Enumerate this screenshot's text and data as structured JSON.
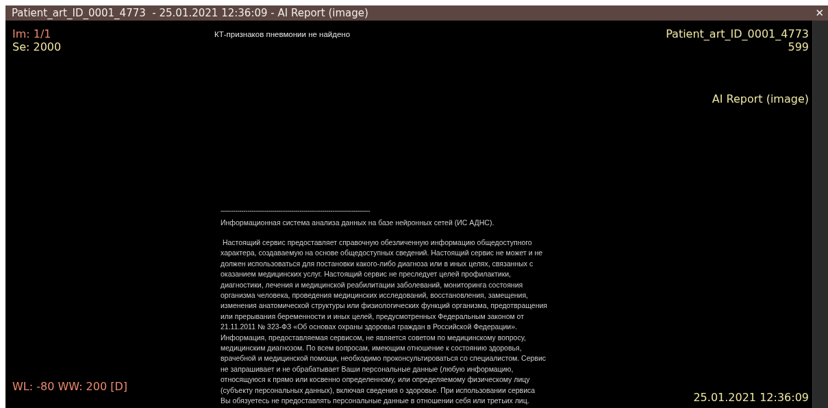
{
  "window": {
    "title": "Patient_art_ID_0001_4773  - 25.01.2021 12:36:09 - AI Report (image)",
    "close": "✕"
  },
  "overlay": {
    "image_index": "Im: 1/1",
    "series": "Se: 2000",
    "patient": "Patient_art_ID_0001_4773",
    "number": "599",
    "description": "AI Report (image)",
    "window_level": "WL: -80 WW: 200 [D]",
    "datetime": "25.01.2021 12:36:09"
  },
  "report": {
    "finding": "КТ-признаков пневмонии не найдено",
    "separator": "------------------------------------------------------------------------",
    "header": " Информационная система анализа данных на базе нейронных сетей (ИС АДНС).",
    "lines": [
      " Настоящий сервис предоставляет справочную обезличенную информацию общедоступного",
      "характера, создаваемую на основе общедоступных сведений. Настоящий сервис не может и не",
      "должен использоваться для постановки какого-либо диагноза или в иных целях, связанных с",
      "оказанием медицинских услуг. Настоящий сервис не преследует целей профилактики,",
      "диагностики, лечения и медицинской реабилитации заболеваний, мониторинга состояния",
      "организма человека, проведения медицинских исследований, восстановления, замещения,",
      "изменения анатомической структуры или физиологических функций организма, предотвращения",
      "или прерывания беременности и иных целей, предусмотренных Федеральным законом от",
      "21.11.2011 № 323-ФЗ «Об основах охраны здоровья граждан в Российской Федерации».",
      "Информация, предоставляемая сервисом, не является советом по медицинскому вопросу,",
      "медицинским диагнозом. По всем вопросам, имеющим отношение к состоянию здоровья,",
      "врачебной и медицинской помощи, необходимо проконсультироваться со специалистом. Сервис",
      "не запрашивает и не обрабатывает Ваши персональные данные (любую информацию,",
      "относящуюся к прямо или косвенно определенному, или определяемому физическому лицу",
      "(субъекту персональных данных), включая сведения о здоровье. При использовании сервиса",
      "Вы обязуетесь не предоставлять персональные данные в отношении себя или третьих лиц."
    ]
  }
}
